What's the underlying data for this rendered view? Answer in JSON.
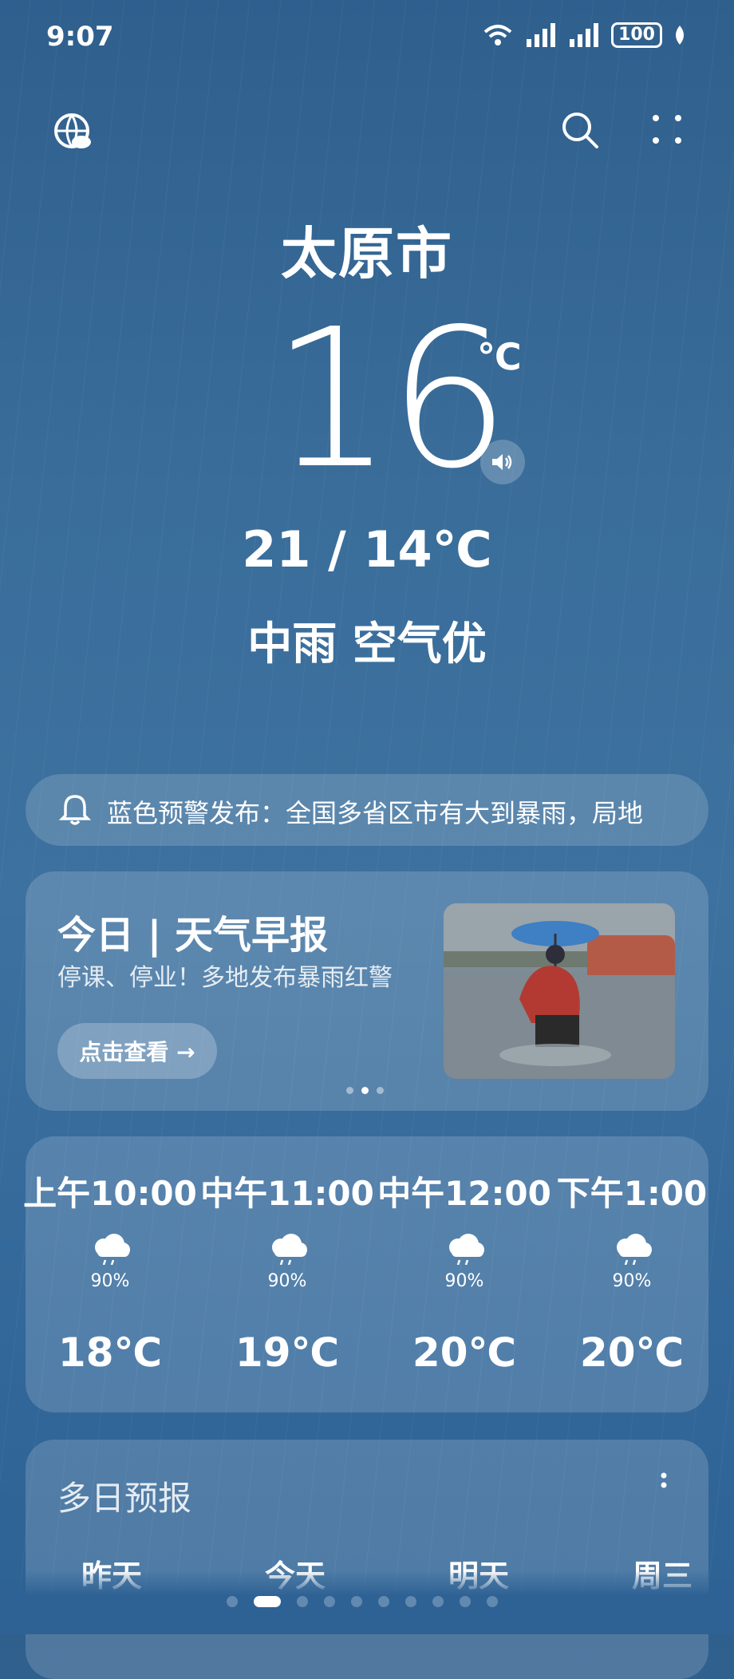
{
  "status": {
    "time": "9:07",
    "battery": "100"
  },
  "header": {
    "city": "太原市"
  },
  "current": {
    "temp": "16",
    "unit": "℃",
    "range": "21 / 14℃",
    "condition": "中雨 空气优"
  },
  "alert": {
    "text": "蓝色预警发布：全国多省区市有大到暴雨，局地"
  },
  "news": {
    "title": "今日 | 天气早报",
    "subtitle": "停课、停业！多地发布暴雨红警",
    "button": "点击查看 →",
    "active_page": 2,
    "page_count": 3
  },
  "hourly": [
    {
      "time": "上午10:00",
      "precip": "90%",
      "temp": "18℃",
      "icon": "rain-cloud-icon"
    },
    {
      "time": "中午11:00",
      "precip": "90%",
      "temp": "19℃",
      "icon": "rain-cloud-icon"
    },
    {
      "time": "中午12:00",
      "precip": "90%",
      "temp": "20℃",
      "icon": "rain-cloud-icon"
    },
    {
      "time": "下午1:00",
      "precip": "90%",
      "temp": "20℃",
      "icon": "rain-cloud-icon"
    }
  ],
  "multi_day": {
    "title": "多日预报",
    "days": [
      "昨天",
      "今天",
      "明天",
      "周三"
    ]
  },
  "pager": {
    "count": 10,
    "active": 2
  },
  "colors": {
    "background_top": "#2f5f8d",
    "background_bottom": "#2d6294",
    "text": "#ffffff"
  }
}
